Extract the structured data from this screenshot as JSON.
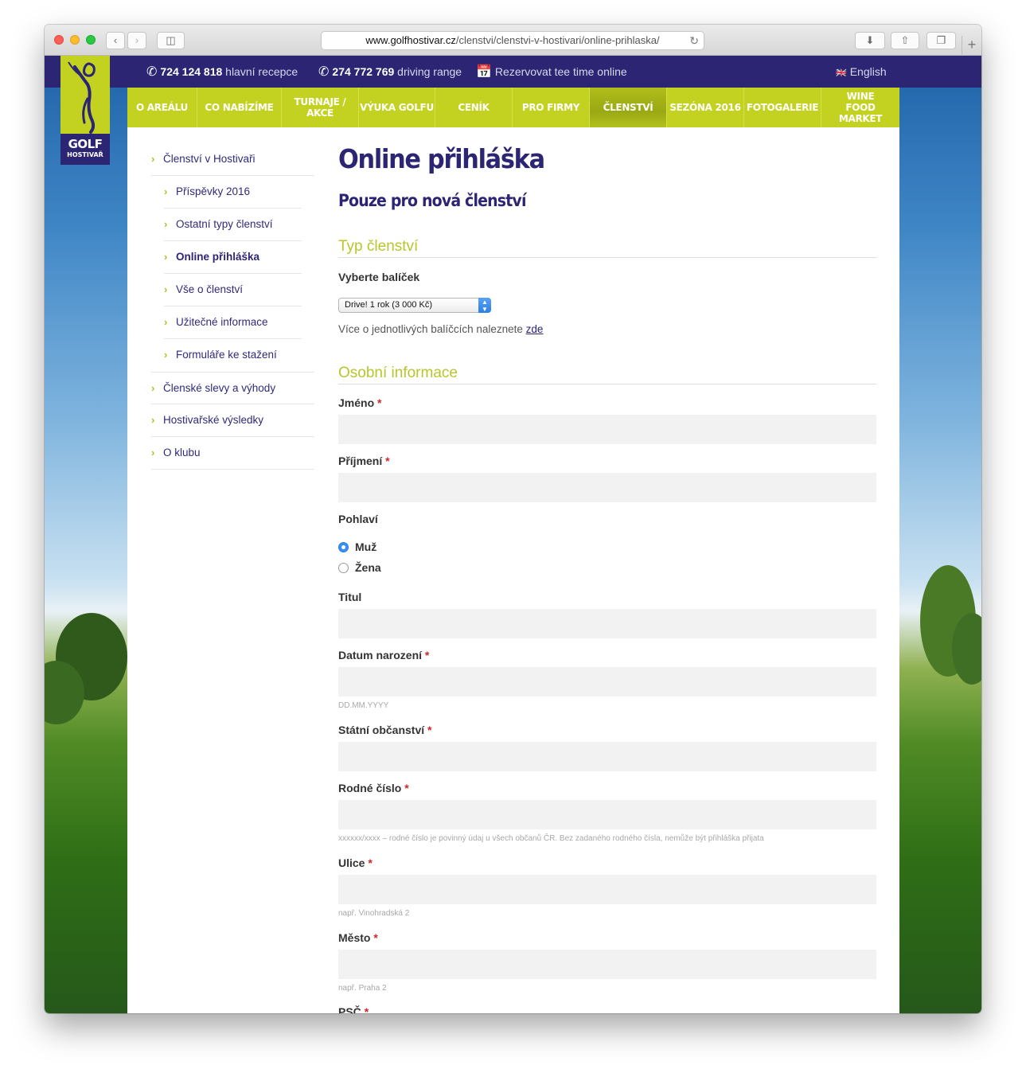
{
  "browser": {
    "url_host": "www.golfhostivar.cz",
    "url_path": "/clenstvi/clenstvi-v-hostivari/online-prihlaska/"
  },
  "topbar": {
    "phone1": "724 124 818",
    "phone1_label": "hlavní recepce",
    "phone2": "274 772 769",
    "phone2_label": "driving range",
    "booking": "Rezervovat tee time online",
    "language": "English"
  },
  "logo": {
    "line1": "GOLF",
    "line2": "HOSTIVAŘ"
  },
  "nav": [
    {
      "label": "O AREÁLU"
    },
    {
      "label": "CO NABÍZÍME"
    },
    {
      "label": "TURNAJE / AKCE"
    },
    {
      "label": "VÝUKA GOLFU"
    },
    {
      "label": "CENÍK"
    },
    {
      "label": "PRO FIRMY"
    },
    {
      "label": "ČLENSTVÍ"
    },
    {
      "label": "SEZÓNA 2016"
    },
    {
      "label": "FOTOGALERIE"
    },
    {
      "label": "WINE FOOD MARKET"
    }
  ],
  "sidebar": {
    "items": [
      {
        "label": "Členství v Hostivaři"
      },
      {
        "label": "Příspěvky 2016"
      },
      {
        "label": "Ostatní typy členství"
      },
      {
        "label": "Online přihláška"
      },
      {
        "label": "Vše o členství"
      },
      {
        "label": "Užitečné informace"
      },
      {
        "label": "Formuláře ke stažení"
      },
      {
        "label": "Členské slevy a výhody"
      },
      {
        "label": "Hostivařské výsledky"
      },
      {
        "label": "O klubu"
      }
    ]
  },
  "main": {
    "title": "Online přihláška",
    "subtitle": "Pouze pro nová členství",
    "section1": "Typ členství",
    "package_label": "Vyberte balíček",
    "package_value": "Drive! 1 rok (3 000 Kč)",
    "package_info": "Více o jednotlivých balíčcích naleznete",
    "package_link": "zde",
    "section2": "Osobní informace",
    "required_mark": "*",
    "jmeno": "Jméno",
    "prijmeni": "Příjmení",
    "pohlavi": "Pohlaví",
    "muz": "Muž",
    "zena": "Žena",
    "titul": "Titul",
    "datum": "Datum narození",
    "datum_hint": "DD.MM.YYYY",
    "obcanstvi": "Státní občanství",
    "rodne": "Rodné číslo",
    "rodne_hint": "xxxxxx/xxxx – rodné číslo je povinný údaj u všech občanů ČR. Bez zadaného rodného čísla, nemůže být přihláška přijata",
    "ulice": "Ulice",
    "ulice_hint": "např. Vinohradská 2",
    "mesto": "Město",
    "mesto_hint": "např. Praha 2",
    "psc": "PSČ"
  }
}
